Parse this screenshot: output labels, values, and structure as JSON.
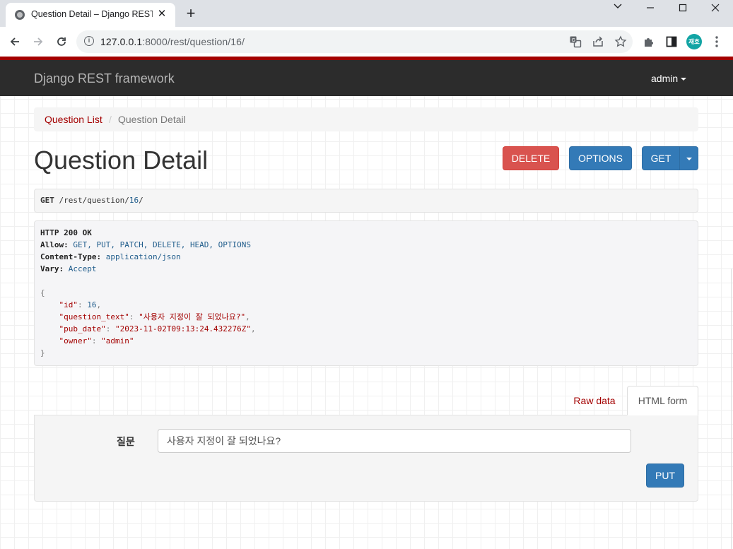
{
  "browser": {
    "tab_title": "Question Detail – Django REST framework",
    "url_host": "127.0.0.1",
    "url_path": ":8000/rest/question/16/",
    "profile_initials": "재호"
  },
  "navbar": {
    "brand": "Django REST framework",
    "user": "admin"
  },
  "breadcrumb": {
    "link": "Question List",
    "separator": "/",
    "active": "Question Detail"
  },
  "page_title": "Question Detail",
  "actions": {
    "delete": "DELETE",
    "options": "OPTIONS",
    "get": "GET"
  },
  "request": {
    "method": "GET",
    "path_prefix": "/rest/question/",
    "id": "16",
    "path_suffix": "/"
  },
  "response": {
    "status": "HTTP 200 OK",
    "allow_label": "Allow:",
    "allow_value": "GET, PUT, PATCH, DELETE, HEAD, OPTIONS",
    "content_type_label": "Content-Type:",
    "content_type_value": "application/json",
    "vary_label": "Vary:",
    "vary_value": "Accept",
    "open_brace": "{",
    "close_brace": "}",
    "fields": [
      {
        "key": "\"id\"",
        "value": "16",
        "type": "number",
        "comma": ","
      },
      {
        "key": "\"question_text\"",
        "value": "\"사용자 지정이 잘 되었나요?\"",
        "type": "string",
        "comma": ","
      },
      {
        "key": "\"pub_date\"",
        "value": "\"2023-11-02T09:13:24.432276Z\"",
        "type": "string",
        "comma": ","
      },
      {
        "key": "\"owner\"",
        "value": "\"admin\"",
        "type": "string",
        "comma": ""
      }
    ]
  },
  "form": {
    "tab_raw": "Raw data",
    "tab_html": "HTML form",
    "label": "질문",
    "value": "사용자 지정이 잘 되었나요?",
    "submit": "PUT"
  }
}
